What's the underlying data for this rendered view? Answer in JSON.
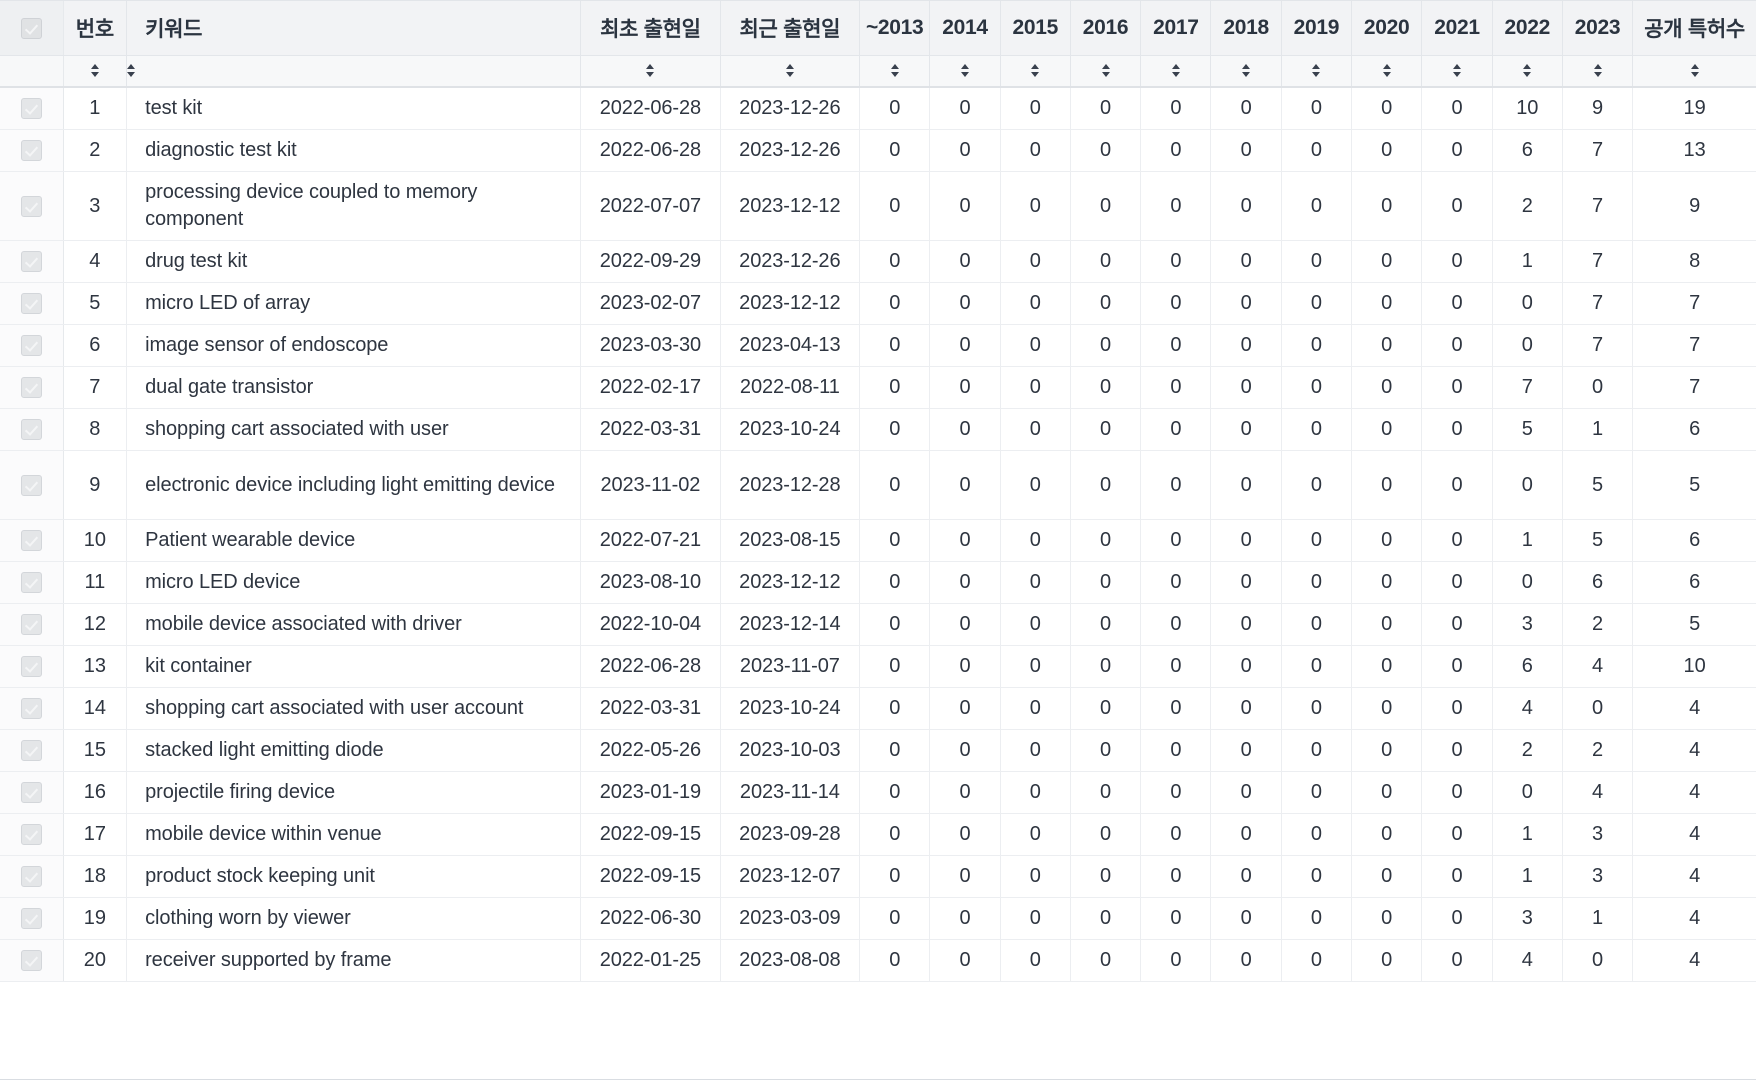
{
  "table": {
    "select_all_checkbox": "checked-disabled",
    "columns": [
      {
        "key": "check",
        "label": "",
        "type": "checkbox"
      },
      {
        "key": "no",
        "label": "번호"
      },
      {
        "key": "keyword",
        "label": "키워드"
      },
      {
        "key": "first",
        "label": "최초 출현일"
      },
      {
        "key": "recent",
        "label": "최근 출현일"
      },
      {
        "key": "y2013",
        "label": "~2013"
      },
      {
        "key": "y2014",
        "label": "2014"
      },
      {
        "key": "y2015",
        "label": "2015"
      },
      {
        "key": "y2016",
        "label": "2016"
      },
      {
        "key": "y2017",
        "label": "2017"
      },
      {
        "key": "y2018",
        "label": "2018"
      },
      {
        "key": "y2019",
        "label": "2019"
      },
      {
        "key": "y2020",
        "label": "2020"
      },
      {
        "key": "y2021",
        "label": "2021"
      },
      {
        "key": "y2022",
        "label": "2022"
      },
      {
        "key": "y2023",
        "label": "2023"
      },
      {
        "key": "total",
        "label": "공개 특허수"
      }
    ],
    "sort_icon": "sort-updown-icon",
    "rows": [
      {
        "no": "1",
        "keyword": "test kit",
        "first": "2022-06-28",
        "recent": "2023-12-26",
        "years": [
          "0",
          "0",
          "0",
          "0",
          "0",
          "0",
          "0",
          "0",
          "0",
          "10",
          "9"
        ],
        "total": "19"
      },
      {
        "no": "2",
        "keyword": "diagnostic test kit",
        "first": "2022-06-28",
        "recent": "2023-12-26",
        "years": [
          "0",
          "0",
          "0",
          "0",
          "0",
          "0",
          "0",
          "0",
          "0",
          "6",
          "7"
        ],
        "total": "13"
      },
      {
        "no": "3",
        "keyword": "processing device coupled to memory component",
        "first": "2022-07-07",
        "recent": "2023-12-12",
        "years": [
          "0",
          "0",
          "0",
          "0",
          "0",
          "0",
          "0",
          "0",
          "0",
          "2",
          "7"
        ],
        "total": "9",
        "tall": true
      },
      {
        "no": "4",
        "keyword": "drug test kit",
        "first": "2022-09-29",
        "recent": "2023-12-26",
        "years": [
          "0",
          "0",
          "0",
          "0",
          "0",
          "0",
          "0",
          "0",
          "0",
          "1",
          "7"
        ],
        "total": "8"
      },
      {
        "no": "5",
        "keyword": "micro LED of array",
        "first": "2023-02-07",
        "recent": "2023-12-12",
        "years": [
          "0",
          "0",
          "0",
          "0",
          "0",
          "0",
          "0",
          "0",
          "0",
          "0",
          "7"
        ],
        "total": "7"
      },
      {
        "no": "6",
        "keyword": "image sensor of endoscope",
        "first": "2023-03-30",
        "recent": "2023-04-13",
        "years": [
          "0",
          "0",
          "0",
          "0",
          "0",
          "0",
          "0",
          "0",
          "0",
          "0",
          "7"
        ],
        "total": "7"
      },
      {
        "no": "7",
        "keyword": "dual gate transistor",
        "first": "2022-02-17",
        "recent": "2022-08-11",
        "years": [
          "0",
          "0",
          "0",
          "0",
          "0",
          "0",
          "0",
          "0",
          "0",
          "7",
          "0"
        ],
        "total": "7"
      },
      {
        "no": "8",
        "keyword": "shopping cart associated with user",
        "first": "2022-03-31",
        "recent": "2023-10-24",
        "years": [
          "0",
          "0",
          "0",
          "0",
          "0",
          "0",
          "0",
          "0",
          "0",
          "5",
          "1"
        ],
        "total": "6"
      },
      {
        "no": "9",
        "keyword": "electronic device including light emitting device",
        "first": "2023-11-02",
        "recent": "2023-12-28",
        "years": [
          "0",
          "0",
          "0",
          "0",
          "0",
          "0",
          "0",
          "0",
          "0",
          "0",
          "5"
        ],
        "total": "5",
        "tall": true
      },
      {
        "no": "10",
        "keyword": "Patient wearable device",
        "first": "2022-07-21",
        "recent": "2023-08-15",
        "years": [
          "0",
          "0",
          "0",
          "0",
          "0",
          "0",
          "0",
          "0",
          "0",
          "1",
          "5"
        ],
        "total": "6"
      },
      {
        "no": "11",
        "keyword": "micro LED device",
        "first": "2023-08-10",
        "recent": "2023-12-12",
        "years": [
          "0",
          "0",
          "0",
          "0",
          "0",
          "0",
          "0",
          "0",
          "0",
          "0",
          "6"
        ],
        "total": "6"
      },
      {
        "no": "12",
        "keyword": "mobile device associated with driver",
        "first": "2022-10-04",
        "recent": "2023-12-14",
        "years": [
          "0",
          "0",
          "0",
          "0",
          "0",
          "0",
          "0",
          "0",
          "0",
          "3",
          "2"
        ],
        "total": "5"
      },
      {
        "no": "13",
        "keyword": "kit container",
        "first": "2022-06-28",
        "recent": "2023-11-07",
        "years": [
          "0",
          "0",
          "0",
          "0",
          "0",
          "0",
          "0",
          "0",
          "0",
          "6",
          "4"
        ],
        "total": "10"
      },
      {
        "no": "14",
        "keyword": "shopping cart associated with user account",
        "first": "2022-03-31",
        "recent": "2023-10-24",
        "years": [
          "0",
          "0",
          "0",
          "0",
          "0",
          "0",
          "0",
          "0",
          "0",
          "4",
          "0"
        ],
        "total": "4"
      },
      {
        "no": "15",
        "keyword": "stacked light emitting diode",
        "first": "2022-05-26",
        "recent": "2023-10-03",
        "years": [
          "0",
          "0",
          "0",
          "0",
          "0",
          "0",
          "0",
          "0",
          "0",
          "2",
          "2"
        ],
        "total": "4"
      },
      {
        "no": "16",
        "keyword": "projectile firing device",
        "first": "2023-01-19",
        "recent": "2023-11-14",
        "years": [
          "0",
          "0",
          "0",
          "0",
          "0",
          "0",
          "0",
          "0",
          "0",
          "0",
          "4"
        ],
        "total": "4"
      },
      {
        "no": "17",
        "keyword": "mobile device within venue",
        "first": "2022-09-15",
        "recent": "2023-09-28",
        "years": [
          "0",
          "0",
          "0",
          "0",
          "0",
          "0",
          "0",
          "0",
          "0",
          "1",
          "3"
        ],
        "total": "4"
      },
      {
        "no": "18",
        "keyword": "product stock keeping unit",
        "first": "2022-09-15",
        "recent": "2023-12-07",
        "years": [
          "0",
          "0",
          "0",
          "0",
          "0",
          "0",
          "0",
          "0",
          "0",
          "1",
          "3"
        ],
        "total": "4"
      },
      {
        "no": "19",
        "keyword": "clothing worn by viewer",
        "first": "2022-06-30",
        "recent": "2023-03-09",
        "years": [
          "0",
          "0",
          "0",
          "0",
          "0",
          "0",
          "0",
          "0",
          "0",
          "3",
          "1"
        ],
        "total": "4"
      },
      {
        "no": "20",
        "keyword": "receiver supported by frame",
        "first": "2022-01-25",
        "recent": "2023-08-08",
        "years": [
          "0",
          "0",
          "0",
          "0",
          "0",
          "0",
          "0",
          "0",
          "0",
          "4",
          "0"
        ],
        "total": "4"
      }
    ]
  },
  "colors": {
    "header_bg": "#f2f3f5",
    "sortrow_bg": "#f7f8f9",
    "border": "#eceef1",
    "text": "#2e3540"
  }
}
